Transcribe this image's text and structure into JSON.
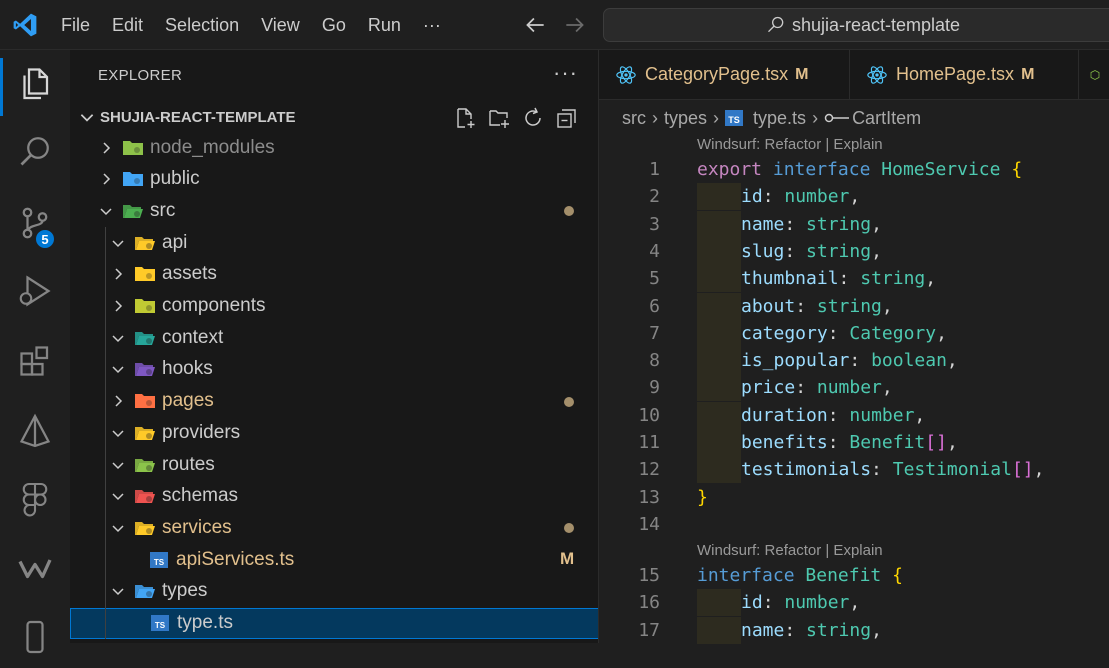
{
  "titlebar": {
    "menu": [
      "File",
      "Edit",
      "Selection",
      "View",
      "Go",
      "Run",
      "···"
    ],
    "search_text": "shujia-react-template"
  },
  "activity": {
    "source_control_badge": "5"
  },
  "explorer": {
    "title": "EXPLORER",
    "more": "···",
    "root": "SHUJIA-REACT-TEMPLATE",
    "items": [
      {
        "label": "node_modules",
        "icon": "node-folder-icon",
        "color": "#8dc149",
        "state": "collapsed",
        "depth": 0,
        "dim": true
      },
      {
        "label": "public",
        "icon": "globe-folder-icon",
        "color": "#42a5f5",
        "state": "collapsed",
        "depth": 0
      },
      {
        "label": "src",
        "icon": "src-folder-icon",
        "color": "#4caf50",
        "state": "expanded",
        "depth": 0,
        "dot": true
      },
      {
        "label": "api",
        "icon": "api-folder-icon",
        "color": "#ffca28",
        "state": "expanded",
        "depth": 1
      },
      {
        "label": "assets",
        "icon": "assets-folder-icon",
        "color": "#ffca28",
        "state": "collapsed",
        "depth": 1
      },
      {
        "label": "components",
        "icon": "components-folder-icon",
        "color": "#c0ca33",
        "state": "collapsed",
        "depth": 1
      },
      {
        "label": "context",
        "icon": "context-folder-icon",
        "color": "#26a69a",
        "state": "expanded",
        "depth": 1
      },
      {
        "label": "hooks",
        "icon": "hooks-folder-icon",
        "color": "#7e57c2",
        "state": "expanded",
        "depth": 1
      },
      {
        "label": "pages",
        "icon": "pages-folder-icon",
        "color": "#ff7043",
        "state": "collapsed",
        "depth": 1,
        "dot": true,
        "modified": true
      },
      {
        "label": "providers",
        "icon": "providers-folder-icon",
        "color": "#ffca28",
        "state": "expanded",
        "depth": 1
      },
      {
        "label": "routes",
        "icon": "routes-folder-icon",
        "color": "#8bc34a",
        "state": "expanded",
        "depth": 1
      },
      {
        "label": "schemas",
        "icon": "schemas-folder-icon",
        "color": "#ef5350",
        "state": "expanded",
        "depth": 1
      },
      {
        "label": "services",
        "icon": "services-folder-icon",
        "color": "#ffca28",
        "state": "expanded",
        "depth": 1,
        "dot": true,
        "modified": true
      },
      {
        "label": "apiServices.ts",
        "icon": "typescript-file-icon",
        "color": "#3178c6",
        "state": "file",
        "depth": 2,
        "m": "M",
        "modified": true
      },
      {
        "label": "types",
        "icon": "types-folder-icon",
        "color": "#42a5f5",
        "state": "expanded",
        "depth": 1
      },
      {
        "label": "type.ts",
        "icon": "typescript-file-icon",
        "color": "#3178c6",
        "state": "file",
        "depth": 2,
        "selected": true
      }
    ]
  },
  "tabs": [
    {
      "name": "CategoryPage.tsx",
      "mod": "M"
    },
    {
      "name": "HomePage.tsx",
      "mod": "M"
    }
  ],
  "breadcrumb": {
    "parts": [
      "src",
      "types",
      "type.ts",
      "CartItem"
    ]
  },
  "editor": {
    "codelens": [
      "Windsurf: Refactor | Explain",
      "Windsurf: Refactor | Explain"
    ],
    "lines": [
      {
        "n": "1",
        "tokens": [
          [
            "k",
            "export"
          ],
          [
            "w",
            " "
          ],
          [
            "b",
            "interface"
          ],
          [
            "w",
            " "
          ],
          [
            "t",
            "HomeService"
          ],
          [
            "w",
            " "
          ],
          [
            "y",
            "{"
          ]
        ]
      },
      {
        "n": "2",
        "indent": true,
        "tokens": [
          [
            "p",
            "id"
          ],
          [
            "w",
            ": "
          ],
          [
            "t",
            "number"
          ],
          [
            "w",
            ","
          ]
        ]
      },
      {
        "n": "3",
        "indent": true,
        "tokens": [
          [
            "p",
            "name"
          ],
          [
            "w",
            ": "
          ],
          [
            "t",
            "string"
          ],
          [
            "w",
            ","
          ]
        ]
      },
      {
        "n": "4",
        "indent": true,
        "tokens": [
          [
            "p",
            "slug"
          ],
          [
            "w",
            ": "
          ],
          [
            "t",
            "string"
          ],
          [
            "w",
            ","
          ]
        ]
      },
      {
        "n": "5",
        "indent": true,
        "tokens": [
          [
            "p",
            "thumbnail"
          ],
          [
            "w",
            ": "
          ],
          [
            "t",
            "string"
          ],
          [
            "w",
            ","
          ]
        ]
      },
      {
        "n": "6",
        "indent": true,
        "tokens": [
          [
            "p",
            "about"
          ],
          [
            "w",
            ": "
          ],
          [
            "t",
            "string"
          ],
          [
            "w",
            ","
          ]
        ]
      },
      {
        "n": "7",
        "indent": true,
        "tokens": [
          [
            "p",
            "category"
          ],
          [
            "w",
            ": "
          ],
          [
            "t",
            "Category"
          ],
          [
            "w",
            ","
          ]
        ]
      },
      {
        "n": "8",
        "indent": true,
        "tokens": [
          [
            "p",
            "is_popular"
          ],
          [
            "w",
            ": "
          ],
          [
            "t",
            "boolean"
          ],
          [
            "w",
            ","
          ]
        ]
      },
      {
        "n": "9",
        "indent": true,
        "tokens": [
          [
            "p",
            "price"
          ],
          [
            "w",
            ": "
          ],
          [
            "t",
            "number"
          ],
          [
            "w",
            ","
          ]
        ]
      },
      {
        "n": "10",
        "indent": true,
        "tokens": [
          [
            "p",
            "duration"
          ],
          [
            "w",
            ": "
          ],
          [
            "t",
            "number"
          ],
          [
            "w",
            ","
          ]
        ]
      },
      {
        "n": "11",
        "indent": true,
        "tokens": [
          [
            "p",
            "benefits"
          ],
          [
            "w",
            ": "
          ],
          [
            "t",
            "Benefit"
          ],
          [
            "m",
            "[]"
          ],
          [
            "w",
            ","
          ]
        ]
      },
      {
        "n": "12",
        "indent": true,
        "tokens": [
          [
            "p",
            "testimonials"
          ],
          [
            "w",
            ": "
          ],
          [
            "t",
            "Testimonial"
          ],
          [
            "m",
            "[]"
          ],
          [
            "w",
            ","
          ]
        ]
      },
      {
        "n": "13",
        "tokens": [
          [
            "y",
            "}"
          ]
        ]
      },
      {
        "n": "14",
        "tokens": []
      },
      {
        "n": "15",
        "tokens": [
          [
            "b",
            "interface"
          ],
          [
            "w",
            " "
          ],
          [
            "t",
            "Benefit"
          ],
          [
            "w",
            " "
          ],
          [
            "y",
            "{"
          ]
        ]
      },
      {
        "n": "16",
        "indent": true,
        "tokens": [
          [
            "p",
            "id"
          ],
          [
            "w",
            ": "
          ],
          [
            "t",
            "number"
          ],
          [
            "w",
            ","
          ]
        ]
      },
      {
        "n": "17",
        "indent": true,
        "tokens": [
          [
            "p",
            "name"
          ],
          [
            "w",
            ": "
          ],
          [
            "t",
            "string"
          ],
          [
            "w",
            ","
          ]
        ]
      }
    ]
  },
  "colors": {
    "accent": "#0078d4",
    "modified": "#e2c08d",
    "selection": "#04395e"
  }
}
